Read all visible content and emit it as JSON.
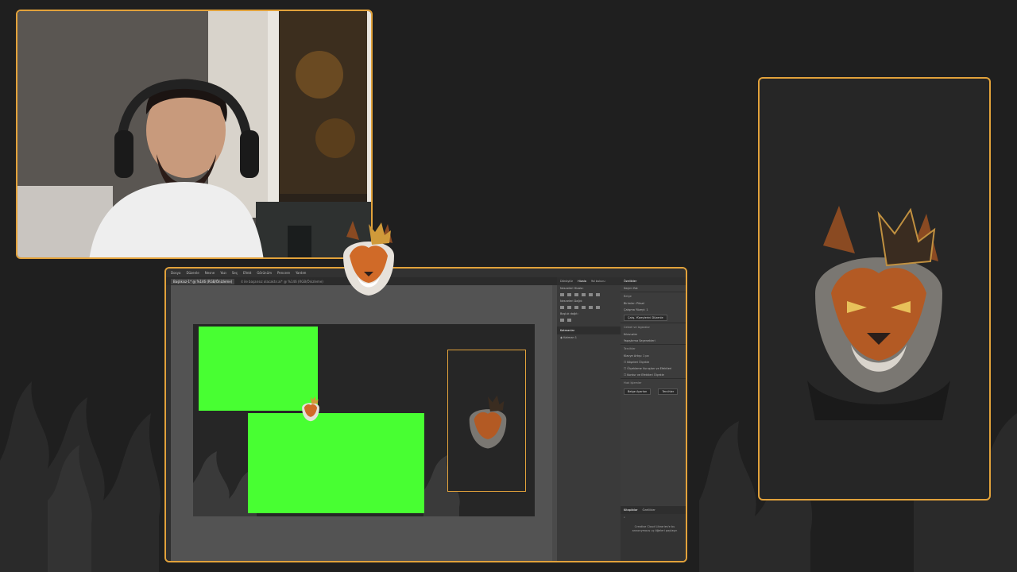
{
  "colors": {
    "frame_accent": "#e2a23b",
    "background": "#1f1f1f",
    "greenscreen": "#48ff32",
    "panel": "#262626"
  },
  "webcam": {
    "label": "webcam-feed"
  },
  "illustrator": {
    "menu": [
      "Dosya",
      "Düzenle",
      "Nesne",
      "Yazı",
      "Seç",
      "Efekt",
      "Görünüm",
      "Pencere",
      "Yardım"
    ],
    "tabs": [
      {
        "label": "Başlıksız-1* @ %146 (RGB/Önizleme)",
        "active": true
      },
      {
        "label": "4 ile başarısız olacaktır.ai* @ %146 (RGB/Önizleme)",
        "active": false
      }
    ],
    "mid_panel": {
      "tabs": [
        "Dönüştür",
        "Hizala",
        "Yol bulucu"
      ],
      "sections": [
        "Nesneleri Hizala:",
        "Nesneleri Dağıt:",
        "Boşluk dağıt:"
      ],
      "layers_title": "Katmanlar",
      "layer_name": "Katman 1"
    },
    "right_panel": {
      "title": "Özellikler",
      "section_select": "Seçim Yok",
      "section_doc": "Belge",
      "units_label": "Birimler",
      "units_value": "Piksel",
      "artboard_label": "Çalışma Yüzeyi",
      "artboard_value": "1",
      "edit_button": "Çalış. Yüzeylerini Düzenle",
      "ruler_label": "Cetvel ve Izgaralar",
      "guides_label": "Kılavuzlar",
      "snap_label": "Yapıştırma Seçenekleri",
      "prefs_label": "Tercihler",
      "keyboard_label": "Klavye Artışı",
      "keyboard_value": "1 px",
      "opt1": "Köşeleri Ölçekle",
      "opt2": "Ölçekleme Vuruşları ve Efektleri",
      "opt3": "Kontur ve Efektleri Ölçekle",
      "quick_label": "Hızlı İşlemler",
      "doc_setup_button": "Belge Ayarları",
      "prefs_button": "Tercihler",
      "library_tabs": [
        "Kitaplıklar",
        "Özellikler"
      ],
      "cc_text": "Creative Cloud Libraries'e bu annonymous uç öğeleri paylaşın"
    }
  }
}
